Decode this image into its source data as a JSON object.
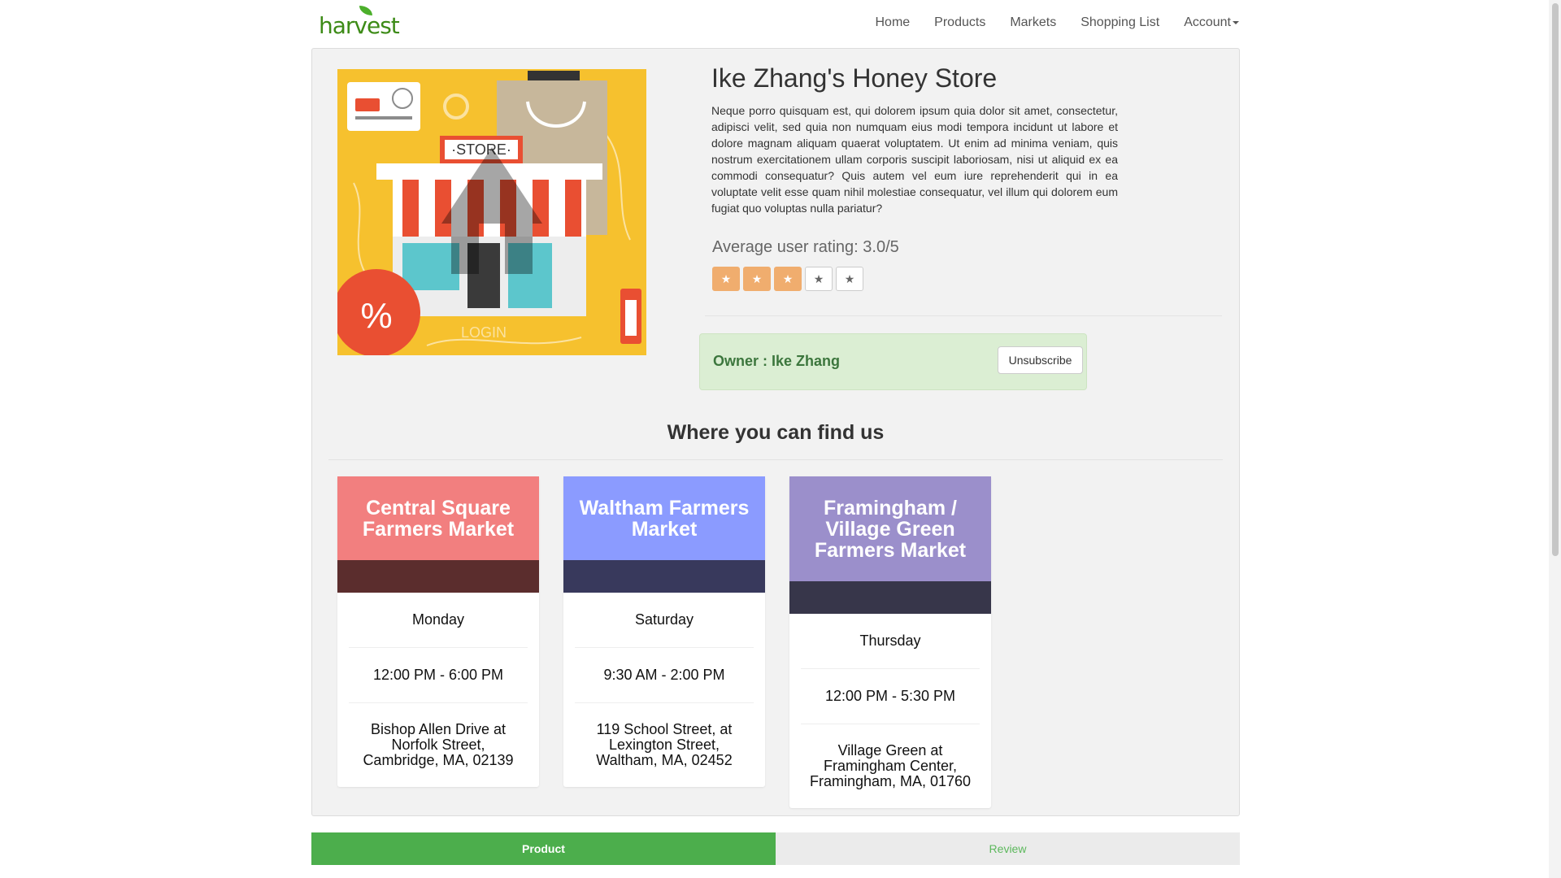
{
  "brand": {
    "logo_text": "harvest"
  },
  "nav": {
    "items": [
      {
        "label": "Home"
      },
      {
        "label": "Products"
      },
      {
        "label": "Markets"
      },
      {
        "label": "Shopping List"
      },
      {
        "label": "Account"
      }
    ]
  },
  "store": {
    "name": "Ike Zhang's Honey Store",
    "image_text": {
      "store_sign": "·STORE·",
      "login": "LOGIN",
      "percent": "%"
    },
    "description": "Neque porro quisquam est, qui dolorem ipsum quia dolor sit amet, consectetur, adipisci velit, sed quia non numquam eius modi tempora incidunt ut labore et dolore magnam aliquam quaerat voluptatem. Ut enim ad minima veniam, quis nostrum exercitationem ullam corporis suscipit laboriosam, nisi ut aliquid ex ea commodi consequatur? Quis autem vel eum iure reprehenderit qui in ea voluptate velit esse quam nihil molestiae consequatur, vel illum qui dolorem eum fugiat quo voluptas nulla pariatur?",
    "rating_label": "Average user rating: 3.0/5",
    "rating_value": 3,
    "rating_max": 5,
    "star_glyph": "★"
  },
  "owner": {
    "label": "Owner : Ike Zhang",
    "unsubscribe_label": "Unsubscribe"
  },
  "locations": {
    "title": "Where you can find us",
    "markets": [
      {
        "name": "Central Square Farmers Market",
        "day": "Monday",
        "hours": "12:00 PM - 6:00 PM",
        "address": "Bishop Allen Drive at Norfolk Street, Cambridge, MA, 02139",
        "head_color": "#f27f7f",
        "band_color": "#5b2d2d"
      },
      {
        "name": "Waltham Farmers Market",
        "day": "Saturday",
        "hours": "9:30 AM - 2:00 PM",
        "address": "119 School Street, at Lexington Street, Waltham, MA, 02452",
        "head_color": "#8b9bff",
        "band_color": "#38395c"
      },
      {
        "name": "Framingham / Village Green Farmers Market",
        "day": "Thursday",
        "hours": "12:00 PM - 5:30 PM",
        "address": "Village Green at Framingham Center, Framingham, MA, 01760",
        "head_color": "#9b8fcb",
        "band_color": "#37364a"
      }
    ]
  },
  "tabs": [
    {
      "label": "Product",
      "active": true
    },
    {
      "label": "Review",
      "active": false
    }
  ]
}
